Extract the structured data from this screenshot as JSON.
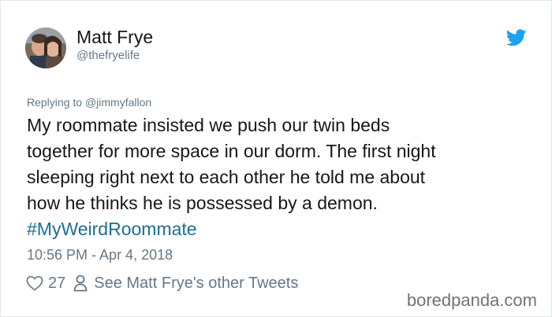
{
  "user": {
    "display_name": "Matt Frye",
    "handle": "@thefryelife"
  },
  "reply": {
    "prefix": "Replying to",
    "mention": "@jimmyfallon"
  },
  "tweet": {
    "lines": [
      "My roommate insisted we push our twin beds",
      "together for more space in our dorm. The first night",
      "sleeping right next to each other he told me about",
      "how he thinks he is possessed by a demon."
    ],
    "hashtag": "#MyWeirdRoommate",
    "timestamp": "10:56 PM - Apr 4, 2018"
  },
  "actions": {
    "likes": "27",
    "other_tweets_label": "See Matt Frye's other Tweets"
  },
  "watermark": "boredpanda.com",
  "icons": {
    "logo": "twitter-bird-icon",
    "like": "heart-icon",
    "profile": "person-icon"
  },
  "colors": {
    "twitter_blue": "#1da1f2",
    "hashtag": "#1b6f95",
    "secondary_text": "#657786",
    "primary_text": "#14171a"
  }
}
